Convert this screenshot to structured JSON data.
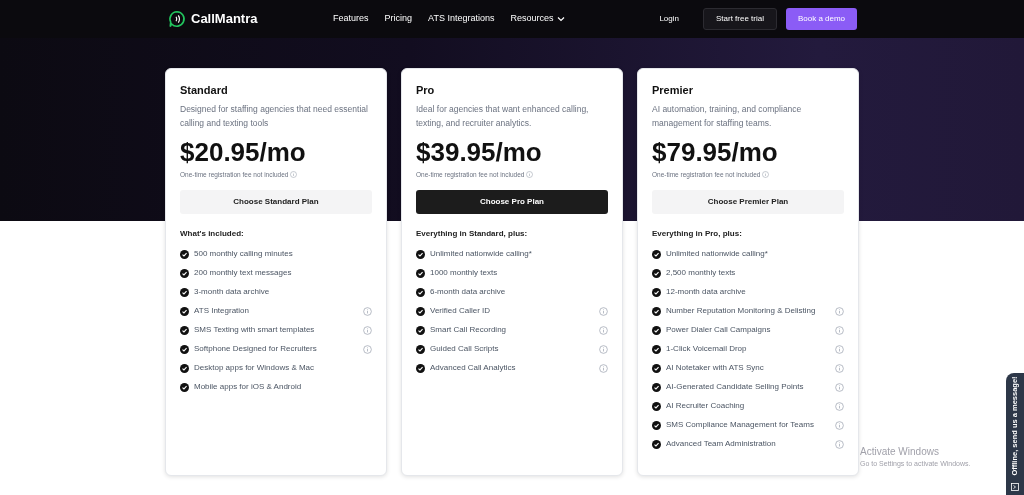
{
  "nav": {
    "brand": "CallMantra",
    "links": [
      {
        "label": "Features",
        "dropdown": false
      },
      {
        "label": "Pricing",
        "dropdown": false
      },
      {
        "label": "ATS Integrations",
        "dropdown": false
      },
      {
        "label": "Resources",
        "dropdown": true
      }
    ],
    "login": "Login",
    "trial": "Start free trial",
    "demo": "Book a demo"
  },
  "plans": [
    {
      "name": "Standard",
      "description": "Designed for staffing agencies that need essential calling and texting tools",
      "price": "$20.95/mo",
      "fee_note": "One-time registration fee not included",
      "button": "Choose Standard Plan",
      "featured": false,
      "features_heading": "What's included:",
      "features": [
        {
          "text": "500 monthly calling minutes",
          "info": false
        },
        {
          "text": "200 monthly text messages",
          "info": false
        },
        {
          "text": "3-month data archive",
          "info": false
        },
        {
          "text": "ATS Integration",
          "info": true
        },
        {
          "text": "SMS Texting with smart templates",
          "info": true
        },
        {
          "text": "Softphone Designed for Recruiters",
          "info": true
        },
        {
          "text": "Desktop apps for Windows & Mac",
          "info": false
        },
        {
          "text": "Mobile apps for iOS & Android",
          "info": false
        }
      ]
    },
    {
      "name": "Pro",
      "description": "Ideal for agencies that want enhanced calling, texting, and recruiter analytics.",
      "price": "$39.95/mo",
      "fee_note": "One-time registration fee not included",
      "button": "Choose Pro Plan",
      "featured": true,
      "features_heading": "Everything in Standard, plus:",
      "features": [
        {
          "text": "Unlimited nationwide calling*",
          "info": false
        },
        {
          "text": "1000 monthly texts",
          "info": false
        },
        {
          "text": "6-month data archive",
          "info": false
        },
        {
          "text": "Verified Caller ID",
          "info": true
        },
        {
          "text": "Smart Call Recording",
          "info": true
        },
        {
          "text": "Guided Call Scripts",
          "info": true
        },
        {
          "text": "Advanced Call Analytics",
          "info": true
        }
      ]
    },
    {
      "name": "Premier",
      "description": "AI automation, training, and compliance management for staffing teams.",
      "price": "$79.95/mo",
      "fee_note": "One-time registration fee not included",
      "button": "Choose Premier Plan",
      "featured": false,
      "features_heading": "Everything in Pro, plus:",
      "features": [
        {
          "text": "Unlimited nationwide calling*",
          "info": false
        },
        {
          "text": "2,500 monthly texts",
          "info": false
        },
        {
          "text": "12-month data archive",
          "info": false
        },
        {
          "text": "Number Reputation Monitoring & Delisting",
          "info": true
        },
        {
          "text": "Power Dialer Call Campaigns",
          "info": true
        },
        {
          "text": "1-Click Voicemail Drop",
          "info": true
        },
        {
          "text": "AI Notetaker with ATS Sync",
          "info": true
        },
        {
          "text": "AI-Generated Candidate Selling Points",
          "info": true
        },
        {
          "text": "AI Recruiter Coaching",
          "info": true
        },
        {
          "text": "SMS Compliance Management for Teams",
          "info": true
        },
        {
          "text": "Advanced Team Administration",
          "info": true
        }
      ]
    }
  ],
  "chat_tab": "Offline, send us a message!",
  "os_notice": {
    "title": "Activate Windows",
    "subtitle": "Go to Settings to activate Windows."
  }
}
